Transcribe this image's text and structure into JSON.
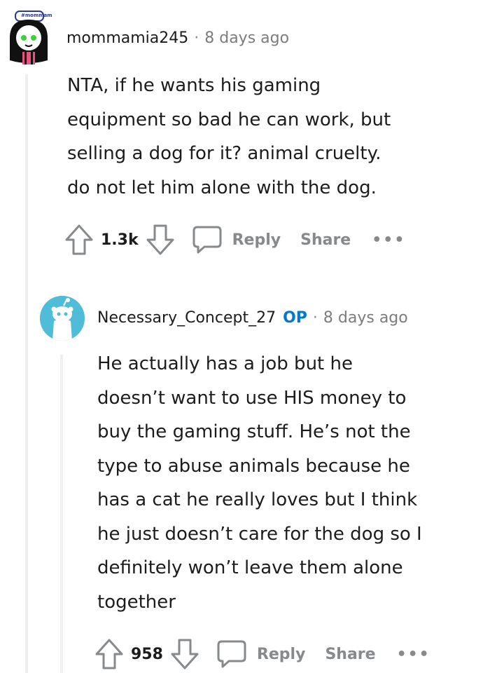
{
  "comments": [
    {
      "username": "mommamia245",
      "time": "8 days ago",
      "body_lines": [
        "NTA, if he wants his gaming",
        "equipment so bad he can work, but",
        "selling a dog for it? animal cruelty.",
        "do not let him alone with the dog."
      ],
      "votes": "1.3k",
      "reply_label": "Reply",
      "share_label": "Share",
      "avatar_badge": "#mommamia"
    },
    {
      "username": "Necessary_Concept_27",
      "op_badge": "OP",
      "time": "8 days ago",
      "body_lines": [
        "He actually has a job but he",
        "doesn’t want to use HIS money to",
        "buy the gaming stuff. He’s not the",
        "type to abuse animals because he",
        "has a cat he really loves but I think",
        "he just doesn’t care for the dog so I",
        "definitely won’t leave them alone",
        "together"
      ],
      "votes": "958",
      "reply_label": "Reply",
      "share_label": "Share"
    }
  ],
  "separator": "·",
  "more_label": "•••",
  "colors": {
    "op": "#0079d3",
    "meta_gray": "#7c7c7c",
    "action_gray": "#878a8c",
    "thread_line": "#edeff1",
    "avatar_blue": "#4fbcd8"
  },
  "icons": [
    "upvote-icon",
    "downvote-icon",
    "comment-icon",
    "snoo-avatar-icon"
  ]
}
